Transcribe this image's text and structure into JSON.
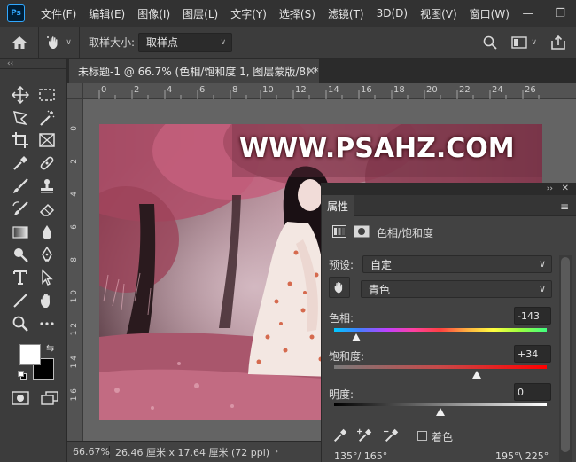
{
  "app": {
    "logo": "Ps"
  },
  "menu": [
    "文件(F)",
    "编辑(E)",
    "图像(I)",
    "图层(L)",
    "文字(Y)",
    "选择(S)",
    "滤镜(T)",
    "3D(D)",
    "视图(V)",
    "窗口(W)",
    "帮"
  ],
  "options_bar": {
    "sample_size_label": "取样大小:",
    "sample_size_value": "取样点"
  },
  "document": {
    "tab_title": "未标题-1 @ 66.7% (色相/饱和度 1, 图层蒙版/8) *",
    "watermark": "WWW.PSAHZ.COM"
  },
  "rulers": {
    "horizontal": [
      "0",
      "2",
      "4",
      "6",
      "8",
      "10",
      "12",
      "14",
      "16",
      "18",
      "20",
      "22",
      "24",
      "26"
    ],
    "vertical": [
      "0",
      "2",
      "4",
      "6",
      "8",
      "1 0",
      "1 2",
      "1 4",
      "1 6"
    ]
  },
  "status": {
    "zoom": "66.67%",
    "info": "26.46 厘米 x 17.64 厘米 (72 ppi)"
  },
  "properties": {
    "tab": "属性",
    "adjustment_name": "色相/饱和度",
    "preset_label": "预设:",
    "preset_value": "自定",
    "channel_value": "青色",
    "hue_label": "色相:",
    "hue_value": "-143",
    "saturation_label": "饱和度:",
    "saturation_value": "+34",
    "lightness_label": "明度:",
    "lightness_value": "0",
    "colorize_label": "着色",
    "range_left": "135°/ 165°",
    "range_right": "195°\\ 225°",
    "slider_levels": {
      "hue": -143,
      "saturation": 34,
      "lightness": 0
    }
  },
  "colors": {
    "foreground": "#ffffff",
    "background": "#000000",
    "accent": "#31a8ff"
  }
}
